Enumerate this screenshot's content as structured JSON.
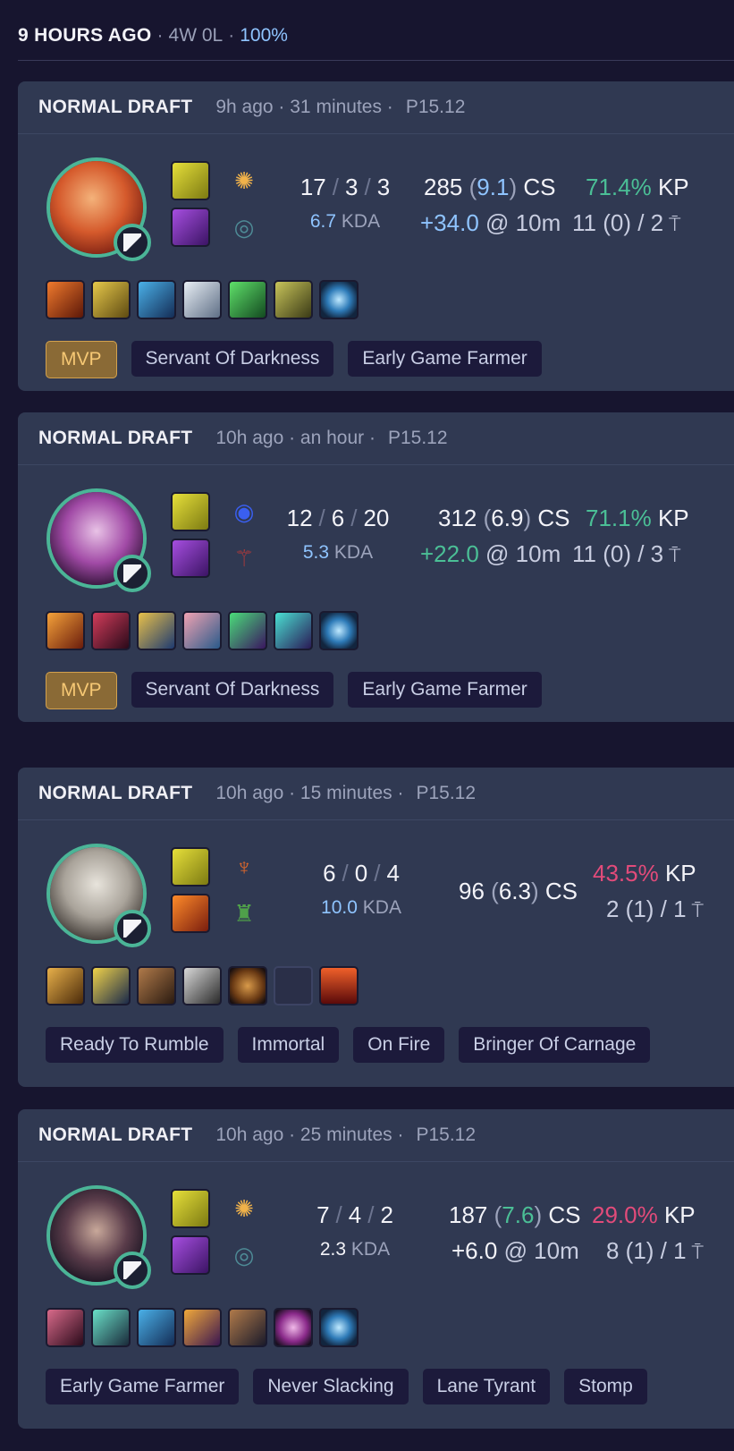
{
  "summary": {
    "when": "9 HOURS AGO",
    "record": "4W 0L",
    "winrate": "100%"
  },
  "matches": [
    {
      "queue": "NORMAL DRAFT",
      "meta": "9h ago · 31 minutes ·",
      "patch": "P15.12",
      "kills": "17",
      "deaths": "3",
      "assists": "3",
      "kda": "6.7",
      "kda_label": "KDA",
      "cs": "285",
      "cs_per_min": "9.1",
      "cs_label": "CS",
      "gold_diff": "+34.0",
      "diff_label": "@ 10m",
      "kp": "71.4%",
      "kp_label": "KP",
      "wards": "11 (0) / 2",
      "tags": [
        "MVP",
        "Servant Of Darkness",
        "Early Game Farmer"
      ]
    },
    {
      "queue": "NORMAL DRAFT",
      "meta": "10h ago · an hour ·",
      "patch": "P15.12",
      "kills": "12",
      "deaths": "6",
      "assists": "20",
      "kda": "5.3",
      "kda_label": "KDA",
      "cs": "312",
      "cs_per_min": "6.9",
      "cs_label": "CS",
      "gold_diff": "+22.0",
      "diff_label": "@ 10m",
      "kp": "71.1%",
      "kp_label": "KP",
      "wards": "11 (0) / 3",
      "tags": [
        "MVP",
        "Servant Of Darkness",
        "Early Game Farmer"
      ]
    },
    {
      "queue": "NORMAL DRAFT",
      "meta": "10h ago · 15 minutes ·",
      "patch": "P15.12",
      "kills": "6",
      "deaths": "0",
      "assists": "4",
      "kda": "10.0",
      "kda_label": "KDA",
      "cs": "96",
      "cs_per_min": "6.3",
      "cs_label": "CS",
      "kp": "43.5%",
      "kp_label": "KP",
      "wards": "2 (1) / 1",
      "tags": [
        "Ready To Rumble",
        "Immortal",
        "On Fire",
        "Bringer Of Carnage"
      ]
    },
    {
      "queue": "NORMAL DRAFT",
      "meta": "10h ago · 25 minutes ·",
      "patch": "P15.12",
      "kills": "7",
      "deaths": "4",
      "assists": "2",
      "kda": "2.3",
      "kda_label": "KDA",
      "cs": "187",
      "cs_per_min": "7.6",
      "cs_label": "CS",
      "gold_diff": "+6.0",
      "diff_label": "@ 10m",
      "kp": "29.0%",
      "kp_label": "KP",
      "wards": "8 (1) / 1",
      "tags": [
        "Early Game Farmer",
        "Never Slacking",
        "Lane Tyrant",
        "Stomp"
      ]
    }
  ],
  "colors": {
    "win_accent": "#4bb597",
    "blue": "#8fc4ff",
    "green": "#4bbf96",
    "red": "#e24b7a",
    "card": "#303952"
  },
  "icons": {
    "role": "mid-lane-icon",
    "ward": "ward-icon",
    "slash": "/"
  }
}
